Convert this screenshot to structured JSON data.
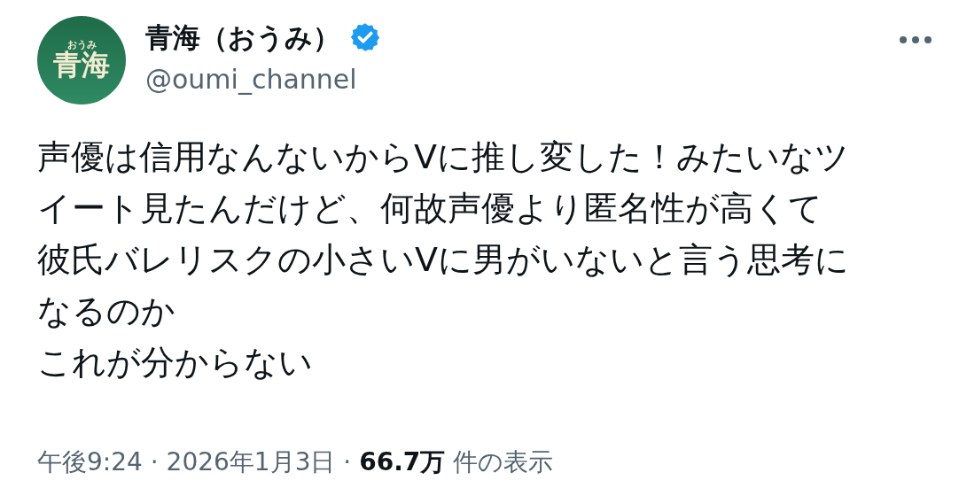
{
  "author": {
    "avatar": {
      "top_text": "おうみ",
      "main_text": "青海"
    },
    "name": "青海（おうみ）",
    "verified": true,
    "handle": "@oumi_channel"
  },
  "body": {
    "lines": [
      "声優は信用なんないからVに推し変した！みたいなツ",
      "イート見たんだけど、何故声優より匿名性が高くて",
      "彼氏バレリスクの小さいVに男がいないと言う思考に",
      "なるのか",
      "これが分からない"
    ]
  },
  "meta": "午後9:24 · 2026年1月3日 · **66.7万** 件の表示"
}
